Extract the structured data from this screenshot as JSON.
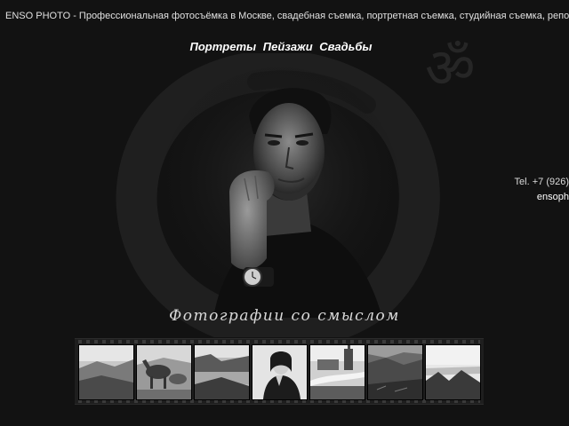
{
  "page": {
    "title": "ENSO PHOTO - Профессиональная фотосъёмка в Москве, свадебная съемка, портретная съемка, студийная съемка, репортажная съёмк"
  },
  "nav": {
    "items": [
      {
        "label": "Портреты"
      },
      {
        "label": "Пейзажи"
      },
      {
        "label": "Свадьбы"
      }
    ]
  },
  "contact": {
    "phone": "Tel. +7 (926)",
    "email": "ensoph"
  },
  "hero": {
    "tagline": "Фотографии со смыслом"
  },
  "gallery": {
    "thumbnails": [
      {
        "icon": "landscape-coast-thumbnail"
      },
      {
        "icon": "horses-thumbnail"
      },
      {
        "icon": "bay-cliffs-thumbnail"
      },
      {
        "icon": "woman-portrait-thumbnail"
      },
      {
        "icon": "town-road-thumbnail"
      },
      {
        "icon": "rocky-hills-thumbnail"
      },
      {
        "icon": "mountain-sea-thumbnail"
      }
    ]
  }
}
